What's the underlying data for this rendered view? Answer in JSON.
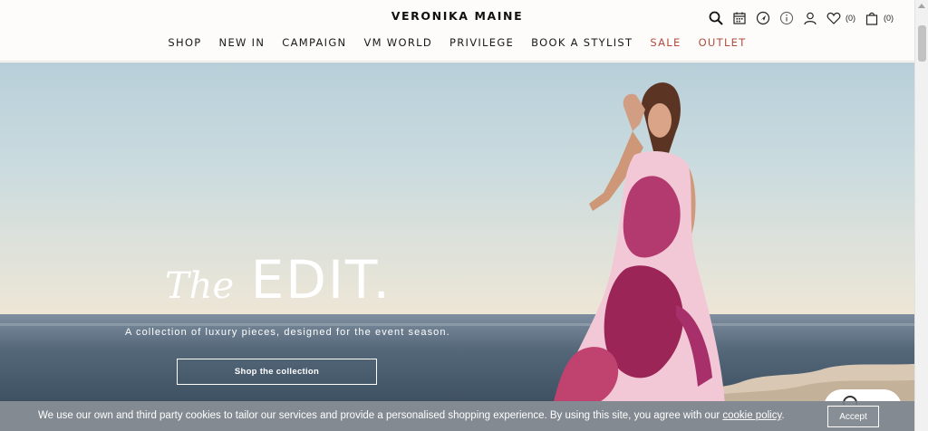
{
  "brand": "VERONIKA MAINE",
  "utilities": {
    "wishlist_count": "(0)",
    "cart_count": "(0)"
  },
  "nav": [
    "SHOP",
    "NEW IN",
    "CAMPAIGN",
    "VM WORLD",
    "PRIVILEGE",
    "BOOK A STYLIST",
    "SALE",
    "OUTLET"
  ],
  "hero": {
    "title_prefix": "The",
    "title_main": "EDIT.",
    "subtitle": "A collection of luxury pieces, designed for the event season.",
    "cta": "Shop the collection"
  },
  "cookie": {
    "text": "We use our own and third party cookies to tailor our services and provide a personalised shopping experience. By using this site, you agree with our ",
    "link": "cookie policy",
    "suffix": ".",
    "accept": "Accept"
  },
  "colors": {
    "accent_sale": "#b24b3c",
    "header_bg": "#fdfcfa",
    "cookie_bg": "#788088"
  }
}
